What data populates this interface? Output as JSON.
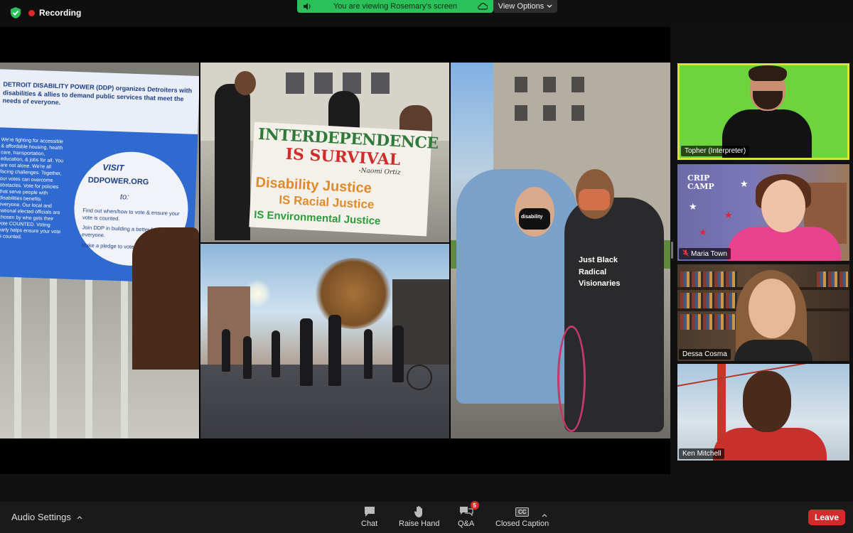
{
  "top_bar": {
    "recording_label": "Recording",
    "viewing_banner": "You are viewing Rosemary's screen",
    "view_options_label": "View Options"
  },
  "shared_screen": {
    "flyer": {
      "headline": "DETROIT DISABILITY POWER (DDP) organizes Detroiters with disabilities & allies to demand public services that meet the needs of everyone.",
      "list": "We're fighting for accessible & affordable housing, health care, transportation, education, & jobs for all. You are not alone. We're all facing challenges. Together, our votes can overcome obstacles. Vote for policies that serve people with disabilities benefits everyone. Our local and national elected officials are chosen by who gets their vote COUNTED. Voting early helps ensure your vote is counted.",
      "visit": "VISIT",
      "url": "DDPOWER.ORG",
      "to": "to:",
      "bullets": [
        "Find out when/how to vote & ensure your vote is counted.",
        "Join DDP in building a better future for everyone.",
        "Make a pledge to vote."
      ]
    },
    "protest_banner": {
      "line1": "INTERDEPENDENCE",
      "line2": "IS SURVIVAL",
      "attribution": "-Naomi Ortiz",
      "line3": "Disability Justice",
      "line4": "IS Racial Justice",
      "line5": "IS Environmental Justice"
    },
    "shirt_text": "Just Black Radical Visionaries",
    "mask_text": "disability"
  },
  "participants": [
    {
      "name": "Topher (Interpreter)",
      "muted": false,
      "active_speaker": true
    },
    {
      "name": "Maria Town",
      "muted": true,
      "background_text": "CRIP CAMP"
    },
    {
      "name": "Dessa Cosma",
      "muted": false
    },
    {
      "name": "Ken Mitchell",
      "muted": false
    }
  ],
  "toolbar": {
    "audio_settings_label": "Audio Settings",
    "chat_label": "Chat",
    "raise_hand_label": "Raise Hand",
    "qa_label": "Q&A",
    "qa_badge": "5",
    "closed_caption_label": "Closed Caption",
    "cc_icon_text": "CC",
    "leave_label": "Leave"
  },
  "colors": {
    "banner_green": "#2bc15a",
    "active_speaker_border": "#d7e23a",
    "leave_red": "#d12b2b",
    "recording_dot": "#e02828"
  }
}
